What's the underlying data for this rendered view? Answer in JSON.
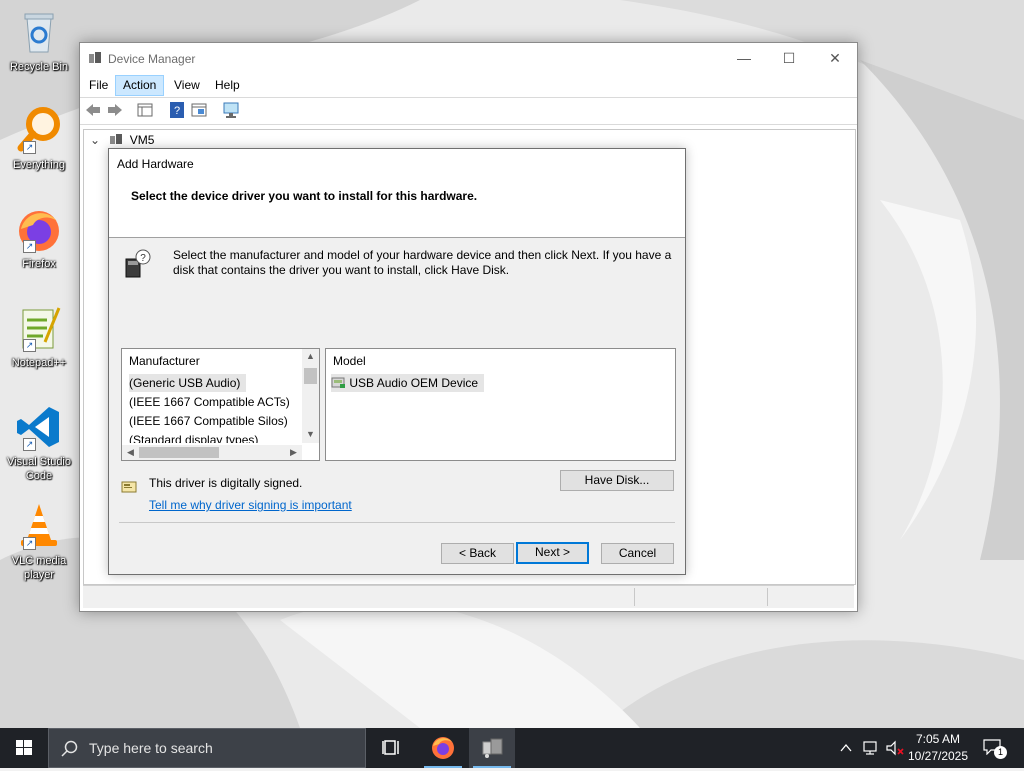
{
  "desktop": {
    "icons": [
      {
        "label": "Recycle Bin"
      },
      {
        "label": "Everything"
      },
      {
        "label": "Firefox"
      },
      {
        "label": "Notepad++"
      },
      {
        "label": "Visual Studio Code"
      },
      {
        "label": "VLC media player"
      }
    ]
  },
  "device_manager": {
    "title": "Device Manager",
    "menu": [
      "File",
      "Action",
      "View",
      "Help"
    ],
    "active_menu": "Action",
    "tree_root": "VM5"
  },
  "add_hardware": {
    "title": "Add Hardware",
    "heading": "Select the device driver you want to install for this hardware.",
    "description": "Select the manufacturer and model of your hardware device and then click Next. If you have a disk that contains the driver you want to install, click Have Disk.",
    "manufacturer_header": "Manufacturer",
    "manufacturers": [
      "(Generic USB Audio)",
      "(IEEE 1667 Compatible ACTs)",
      "(IEEE 1667 Compatible Silos)",
      "(Standard display types)"
    ],
    "model_header": "Model",
    "models": [
      "USB Audio OEM Device"
    ],
    "signed_text": "This driver is digitally signed.",
    "signing_link": "Tell me why driver signing is important",
    "have_disk_button": "Have Disk...",
    "back_button": "< Back",
    "next_button": "Next >",
    "cancel_button": "Cancel"
  },
  "taskbar": {
    "search_placeholder": "Type here to search",
    "time": "7:05 AM",
    "date": "10/27/2025",
    "notification_count": "1"
  },
  "colors": {
    "accent": "#0078d7",
    "link": "#0066cc",
    "taskbar": "#1f2227"
  }
}
